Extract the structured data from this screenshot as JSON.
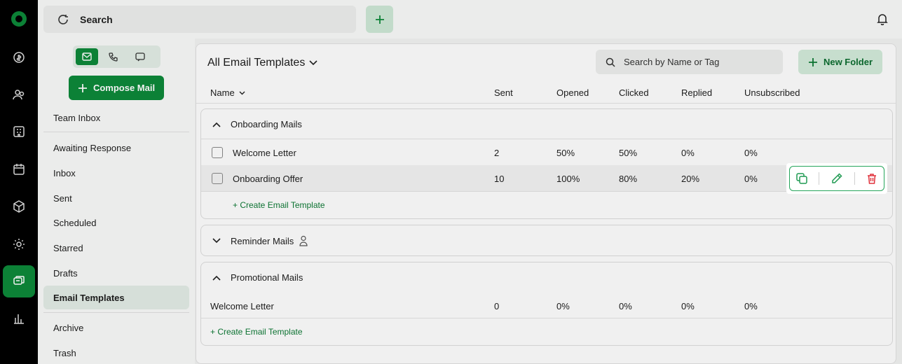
{
  "topbar": {
    "search_label": "Search"
  },
  "sidebar": {
    "compose_label": "Compose Mail",
    "items": [
      {
        "label": "Team Inbox"
      },
      {
        "label": "Awaiting Response"
      },
      {
        "label": "Inbox"
      },
      {
        "label": "Sent"
      },
      {
        "label": "Scheduled"
      },
      {
        "label": "Starred"
      },
      {
        "label": "Drafts"
      },
      {
        "label": "Email Templates"
      },
      {
        "label": "Archive"
      },
      {
        "label": "Trash"
      }
    ]
  },
  "main": {
    "title": "All Email Templates",
    "search_placeholder": "Search by Name or Tag",
    "new_folder_label": "New Folder",
    "columns": [
      "Name",
      "Sent",
      "Opened",
      "Clicked",
      "Replied",
      "Unsubscribed"
    ],
    "groups": [
      {
        "name": "Onboarding Mails",
        "rows": [
          {
            "name": "Welcome Letter",
            "sent": "2",
            "opened": "50%",
            "clicked": "50%",
            "replied": "0%",
            "unsubscribed": "0%"
          },
          {
            "name": "Onboarding Offer",
            "sent": "10",
            "opened": "100%",
            "clicked": "80%",
            "replied": "20%",
            "unsubscribed": "0%"
          }
        ],
        "create_label": "+ Create Email Template"
      },
      {
        "name": "Reminder Mails"
      },
      {
        "name": "Promotional Mails",
        "rows": [
          {
            "name": "Welcome Letter",
            "sent": "0",
            "opened": "0%",
            "clicked": "0%",
            "replied": "0%",
            "unsubscribed": "0%"
          }
        ],
        "create_label": "+ Create Email Template"
      }
    ]
  },
  "colors": {
    "accent": "#0d8a3a",
    "danger": "#e0323c"
  }
}
